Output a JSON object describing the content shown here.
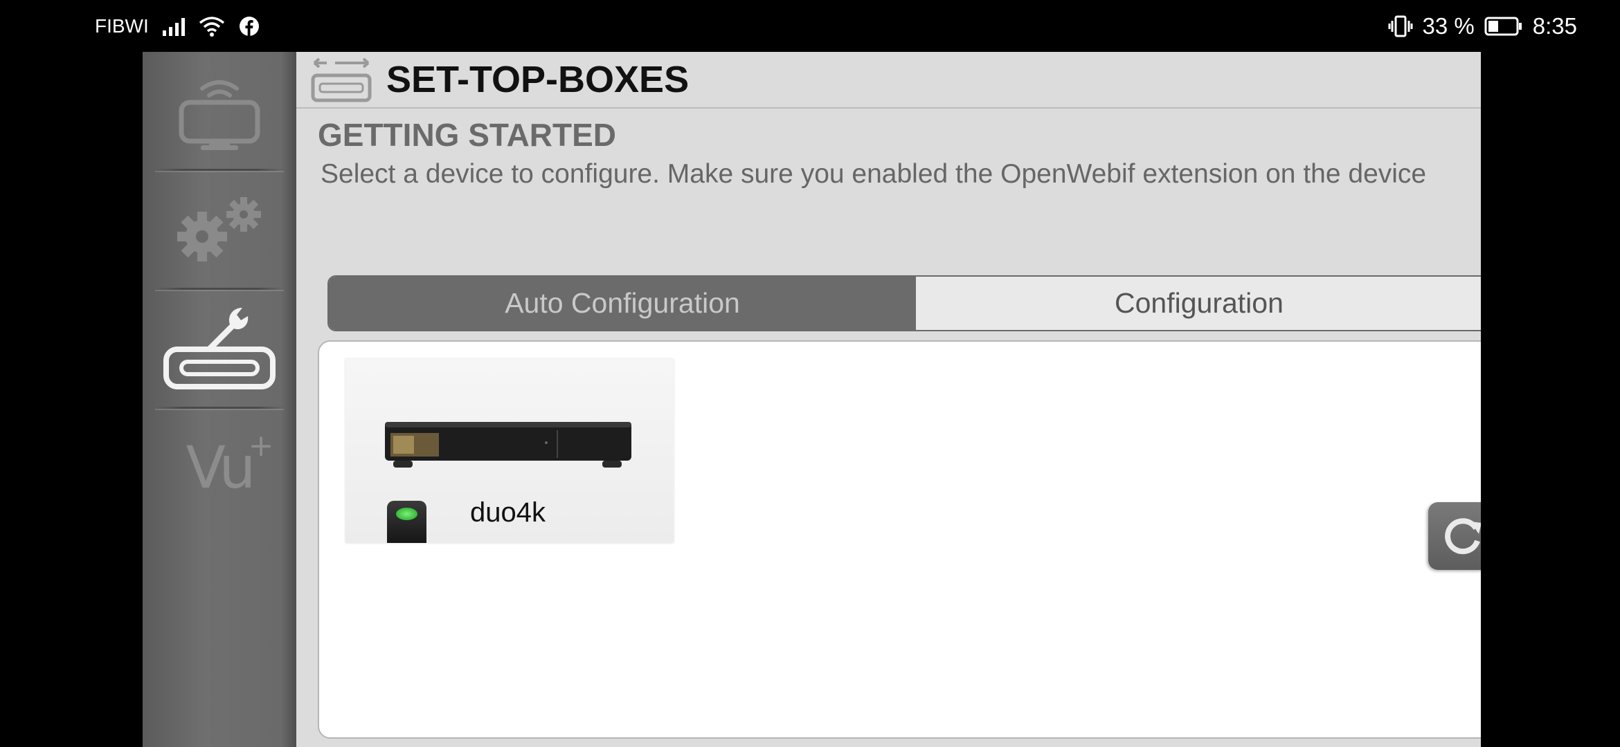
{
  "status_bar": {
    "carrier": "FIBWI",
    "battery_percent": "33 %",
    "time": "8:35",
    "icons": [
      "signal-icon",
      "wifi-icon",
      "facebook-icon",
      "vibrate-icon",
      "battery-icon"
    ]
  },
  "sidebar": {
    "items": [
      {
        "name": "remote-tv",
        "icon": "tv-wifi-icon"
      },
      {
        "name": "settings",
        "icon": "gears-icon"
      },
      {
        "name": "set-top-boxes",
        "icon": "wrench-box-icon"
      },
      {
        "name": "vu-plus",
        "icon": "vu-logo-icon",
        "logo_text": "Vu",
        "logo_sup": "+"
      }
    ]
  },
  "header": {
    "title": "SET-TOP-BOXES",
    "icon": "set-top-box-swap-icon"
  },
  "main": {
    "section_title": "GETTING STARTED",
    "subtitle": "Select a device to configure. Make sure you enabled the OpenWebif extension on the device",
    "tabs": [
      {
        "label": "Auto Configuration",
        "active": true
      },
      {
        "label": "Configuration",
        "active": false
      }
    ],
    "devices": [
      {
        "name": "duo4k",
        "status": "online",
        "status_color": "#2ecc40"
      }
    ],
    "refresh_icon": "refresh-icon"
  },
  "colors": {
    "sidebar": "#6a6a6a",
    "background": "#dcdcdc",
    "active_tab": "#6b6b6b",
    "panel": "#ffffff"
  }
}
